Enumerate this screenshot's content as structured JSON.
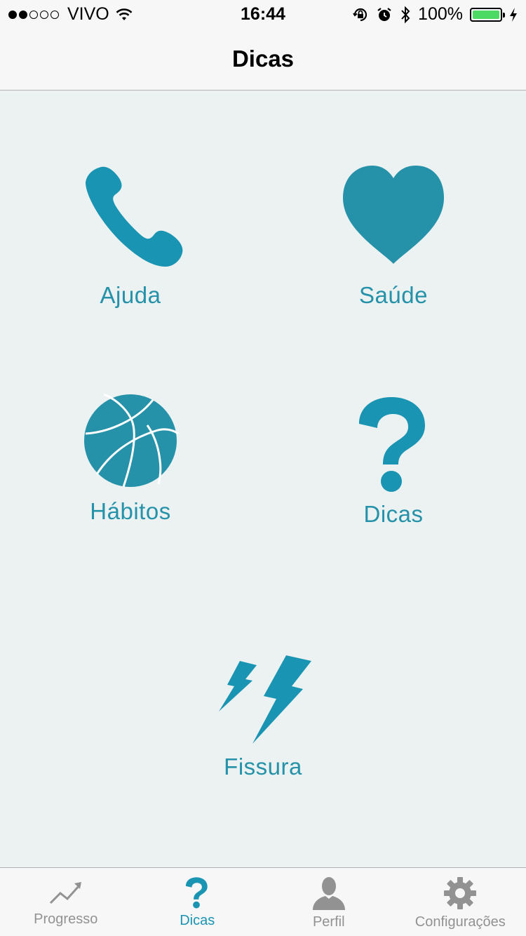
{
  "status_bar": {
    "carrier": "VIVO",
    "time": "16:44",
    "battery": "100%",
    "signal_bars_filled": 2,
    "signal_bars_total": 5,
    "battery_level": 1.0
  },
  "nav": {
    "title": "Dicas"
  },
  "tiles": {
    "ajuda": {
      "label": "Ajuda",
      "icon": "phone-icon"
    },
    "saude": {
      "label": "Saúde",
      "icon": "heart-icon"
    },
    "habitos": {
      "label": "Hábitos",
      "icon": "basketball-icon"
    },
    "dicas": {
      "label": "Dicas",
      "icon": "question-icon"
    },
    "fissura": {
      "label": "Fissura",
      "icon": "lightning-icon"
    }
  },
  "tabbar": {
    "items": [
      {
        "label": "Progresso",
        "icon": "trend-chart-icon",
        "active": false
      },
      {
        "label": "Dicas",
        "icon": "question-icon",
        "active": true
      },
      {
        "label": "Perfil",
        "icon": "person-icon",
        "active": false
      },
      {
        "label": "Configurações",
        "icon": "gear-icon",
        "active": false
      }
    ]
  },
  "colors": {
    "accent": "#1a94b3",
    "icon": "#2592aa",
    "background": "#ebf2f1",
    "tab_inactive": "#929292"
  }
}
